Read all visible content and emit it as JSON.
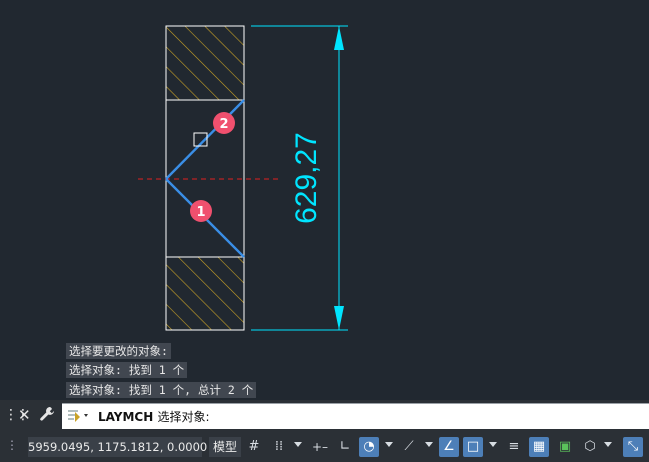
{
  "drawing": {
    "dimension_text": "629,27",
    "marker_1": "1",
    "marker_2": "2"
  },
  "history": [
    "选择要更改的对象:",
    "选择对象: 找到 1 个",
    "选择对象: 找到 1 个, 总计 2 个"
  ],
  "command": {
    "name": "LAYMCH",
    "prompt": "选择对象:"
  },
  "status": {
    "coordinates": "5959.0495, 1175.1812, 0.0000",
    "model_label": "模型"
  },
  "colors": {
    "background": "#212830",
    "outline": "#ffffff",
    "hatch": "#c9a227",
    "dimension": "#00e5ff",
    "selected": "#3a8ee6",
    "centerline": "#e02020",
    "marker": "#f0506e"
  }
}
